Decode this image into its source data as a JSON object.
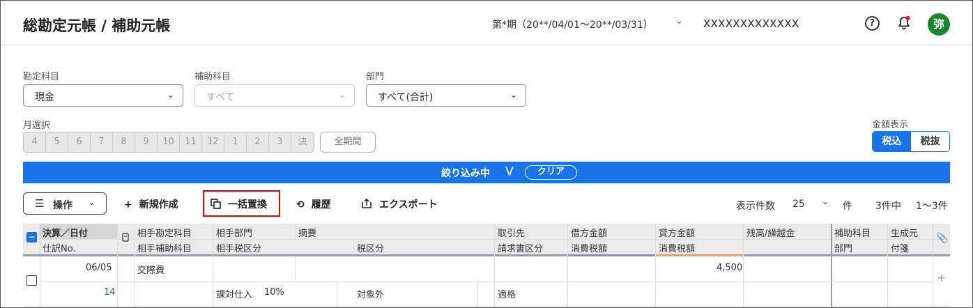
{
  "header": {
    "title": "総勘定元帳 / 補助元帳",
    "period": "第*期（20**/04/01〜20**/03/31）",
    "company": "XXXXXXXXXXXXX",
    "avatar_char": "弥",
    "avatar_color": "#18872e"
  },
  "filters": {
    "account_label": "勘定科目",
    "account_value": "現金",
    "sub_account_label": "補助科目",
    "sub_account_value": "すべて",
    "department_label": "部門",
    "department_value": "すべて(合計)",
    "month_label": "月選択",
    "months": [
      "4",
      "5",
      "6",
      "7",
      "8",
      "9",
      "10",
      "11",
      "12",
      "1",
      "2",
      "3",
      "決"
    ],
    "all_period": "全期間",
    "amount_display_label": "金額表示",
    "amount_options": [
      "税込",
      "税抜"
    ],
    "amount_selected": "税込"
  },
  "filter_bar": {
    "text": "絞り込み中",
    "clear": "クリア",
    "color": "#1a73e8"
  },
  "toolbar": {
    "operations": "操作",
    "new": "新規作成",
    "bulk_replace": "一括置換",
    "history": "履歴",
    "export": "エクスポート",
    "per_page_label": "表示件数",
    "per_page_value": "25",
    "per_page_unit": "件",
    "count": "3件中",
    "range": "1〜3件"
  },
  "table": {
    "headers": {
      "date_top": "決算／日付",
      "date_bottom": "仕訳No.",
      "counter_account": "相手勘定科目",
      "counter_sub": "相手補助科目",
      "counter_dept": "相手部門",
      "counter_tax": "相手税区分",
      "memo": "摘要",
      "tax_class": "税区分",
      "partner": "取引先",
      "invoice_class": "請求書区分",
      "debit": "借方金額",
      "debit_tax": "消費税額",
      "credit": "貸方金額",
      "credit_tax": "消費税額",
      "balance": "残高/繰越金",
      "sub_account": "補助科目",
      "department": "部門",
      "source": "生成元",
      "tag": "付箋"
    },
    "rows": [
      {
        "date": "06/05",
        "no": "14",
        "counter_account": "交際費",
        "counter_tax": "課対仕入",
        "counter_tax_rate": "10%",
        "tax_class": "対象外",
        "invoice_class": "適格",
        "credit": "4,500"
      }
    ]
  }
}
